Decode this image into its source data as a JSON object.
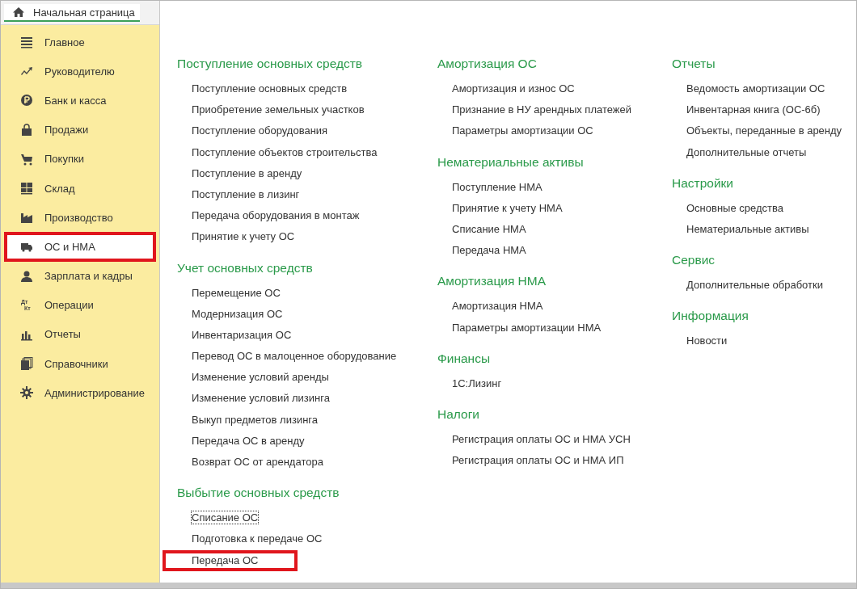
{
  "tab": {
    "label": "Начальная страница",
    "selected": true
  },
  "sidebar": {
    "items": [
      {
        "label": "Главное",
        "selected": false,
        "highlighted": false
      },
      {
        "label": "Руководителю",
        "selected": false,
        "highlighted": false
      },
      {
        "label": "Банк и касса",
        "selected": false,
        "highlighted": false
      },
      {
        "label": "Продажи",
        "selected": false,
        "highlighted": false
      },
      {
        "label": "Покупки",
        "selected": false,
        "highlighted": false
      },
      {
        "label": "Склад",
        "selected": false,
        "highlighted": false
      },
      {
        "label": "Производство",
        "selected": false,
        "highlighted": false
      },
      {
        "label": "ОС и НМА",
        "selected": true,
        "highlighted": true
      },
      {
        "label": "Зарплата и кадры",
        "selected": false,
        "highlighted": false
      },
      {
        "label": "Операции",
        "selected": false,
        "highlighted": false,
        "icon_text": [
          "Дт",
          "Кт"
        ]
      },
      {
        "label": "Отчеты",
        "selected": false,
        "highlighted": false
      },
      {
        "label": "Справочники",
        "selected": false,
        "highlighted": false
      },
      {
        "label": "Администрирование",
        "selected": false,
        "highlighted": false
      }
    ]
  },
  "columns": [
    {
      "groups": [
        {
          "title": "Поступление основных средств",
          "links": [
            {
              "label": "Поступление основных средств",
              "focused": false,
              "highlighted": false
            },
            {
              "label": "Приобретение земельных участков",
              "focused": false,
              "highlighted": false
            },
            {
              "label": "Поступление оборудования",
              "focused": false,
              "highlighted": false
            },
            {
              "label": "Поступление объектов строительства",
              "focused": false,
              "highlighted": false
            },
            {
              "label": "Поступление в аренду",
              "focused": false,
              "highlighted": false
            },
            {
              "label": "Поступление в лизинг",
              "focused": false,
              "highlighted": false
            },
            {
              "label": "Передача оборудования в монтаж",
              "focused": false,
              "highlighted": false
            },
            {
              "label": "Принятие к учету ОС",
              "focused": false,
              "highlighted": false
            }
          ]
        },
        {
          "title": "Учет основных средств",
          "links": [
            {
              "label": "Перемещение ОС",
              "focused": false,
              "highlighted": false
            },
            {
              "label": "Модернизация ОС",
              "focused": false,
              "highlighted": false
            },
            {
              "label": "Инвентаризация ОС",
              "focused": false,
              "highlighted": false
            },
            {
              "label": "Перевод ОС в малоценное оборудование",
              "focused": false,
              "highlighted": false
            },
            {
              "label": "Изменение условий аренды",
              "focused": false,
              "highlighted": false
            },
            {
              "label": "Изменение условий лизинга",
              "focused": false,
              "highlighted": false
            },
            {
              "label": "Выкуп предметов лизинга",
              "focused": false,
              "highlighted": false
            },
            {
              "label": "Передача ОС в аренду",
              "focused": false,
              "highlighted": false
            },
            {
              "label": "Возврат ОС от арендатора",
              "focused": false,
              "highlighted": false
            }
          ]
        },
        {
          "title": "Выбытие основных средств",
          "links": [
            {
              "label": "Списание ОС",
              "focused": true,
              "highlighted": false
            },
            {
              "label": "Подготовка к передаче ОС",
              "focused": false,
              "highlighted": false
            },
            {
              "label": "Передача ОС",
              "focused": false,
              "highlighted": true
            }
          ]
        }
      ]
    },
    {
      "groups": [
        {
          "title": "Амортизация ОС",
          "links": [
            {
              "label": "Амортизация и износ ОС",
              "focused": false,
              "highlighted": false
            },
            {
              "label": "Признание в НУ арендных платежей",
              "focused": false,
              "highlighted": false
            },
            {
              "label": "Параметры амортизации ОС",
              "focused": false,
              "highlighted": false
            }
          ]
        },
        {
          "title": "Нематериальные активы",
          "links": [
            {
              "label": "Поступление НМА",
              "focused": false,
              "highlighted": false
            },
            {
              "label": "Принятие к учету НМА",
              "focused": false,
              "highlighted": false
            },
            {
              "label": "Списание НМА",
              "focused": false,
              "highlighted": false
            },
            {
              "label": "Передача НМА",
              "focused": false,
              "highlighted": false
            }
          ]
        },
        {
          "title": "Амортизация НМА",
          "links": [
            {
              "label": "Амортизация НМА",
              "focused": false,
              "highlighted": false
            },
            {
              "label": "Параметры амортизации НМА",
              "focused": false,
              "highlighted": false
            }
          ]
        },
        {
          "title": "Финансы",
          "links": [
            {
              "label": "1С:Лизинг",
              "focused": false,
              "highlighted": false
            }
          ]
        },
        {
          "title": "Налоги",
          "links": [
            {
              "label": "Регистрация оплаты ОС и НМА УСН",
              "focused": false,
              "highlighted": false
            },
            {
              "label": "Регистрация оплаты ОС и НМА ИП",
              "focused": false,
              "highlighted": false
            }
          ]
        }
      ]
    },
    {
      "groups": [
        {
          "title": "Отчеты",
          "links": [
            {
              "label": "Ведомость амортизации ОС",
              "focused": false,
              "highlighted": false
            },
            {
              "label": "Инвентарная книга (ОС-6б)",
              "focused": false,
              "highlighted": false
            },
            {
              "label": "Объекты, переданные в аренду",
              "focused": false,
              "highlighted": false
            },
            {
              "label": "Дополнительные отчеты",
              "focused": false,
              "highlighted": false
            }
          ]
        },
        {
          "title": "Настройки",
          "links": [
            {
              "label": "Основные средства",
              "focused": false,
              "highlighted": false
            },
            {
              "label": "Нематериальные активы",
              "focused": false,
              "highlighted": false
            }
          ]
        },
        {
          "title": "Сервис",
          "links": [
            {
              "label": "Дополнительные обработки",
              "focused": false,
              "highlighted": false
            }
          ]
        },
        {
          "title": "Информация",
          "links": [
            {
              "label": "Новости",
              "focused": false,
              "highlighted": false
            }
          ]
        }
      ]
    }
  ]
}
